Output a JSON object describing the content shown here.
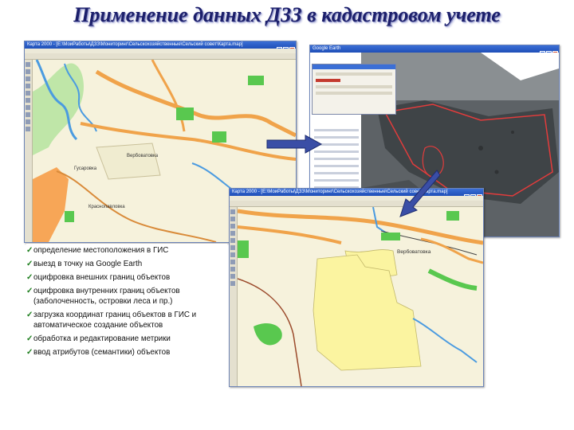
{
  "title": "Применение данных ДЗЗ в кадастровом учете",
  "windows": {
    "gis_main": {
      "title": "Карта 2000 - [E:\\МоиРаботы\\ДЗЗ\\Мониторинг\\Сельскохозяйственные\\Сельский совет\\Карта.map]"
    },
    "google_earth": {
      "title": "Google Earth"
    },
    "gis_detail": {
      "title": "Карта 2000 - [E:\\МоиРаботы\\ДЗЗ\\Мониторинг\\Сельскохозяйственные\\Сельский совет\\Карта.map]"
    }
  },
  "map_labels": {
    "main_label_1": "Вербоватовка",
    "main_label_2": "Гусаровка",
    "main_label_3": "Краснопавловка",
    "detail_label_1": "Вербоватовка"
  },
  "bullets": [
    {
      "text": "определение местоположения в ГИС"
    },
    {
      "text": "выезд в точку на Google Earth"
    },
    {
      "text": "оцифровка внешних границ объектов"
    },
    {
      "text": "оцифровка внутренних границ объектов (заболоченность, островки леса и пр.)"
    },
    {
      "text": "загрузка координат границ объектов в ГИС и автоматическое создание объектов"
    },
    {
      "text": "обработка и редактирование метрики"
    },
    {
      "text": "ввод атрибутов (семантики) объектов"
    }
  ],
  "colors": {
    "title": "#1c1f6b",
    "check": "#1b7d1b",
    "map_background": "#f6f2dc",
    "water": "#4b9be0",
    "road": "#f0a34a",
    "forest": "#59c84f",
    "cadastre_parcel": "#fbf4a0",
    "boundary": "#e23c3c",
    "arrow": "#3a4ea6"
  },
  "icons": {
    "check": "checkmark-icon",
    "arrow": "arrow-right-icon"
  }
}
